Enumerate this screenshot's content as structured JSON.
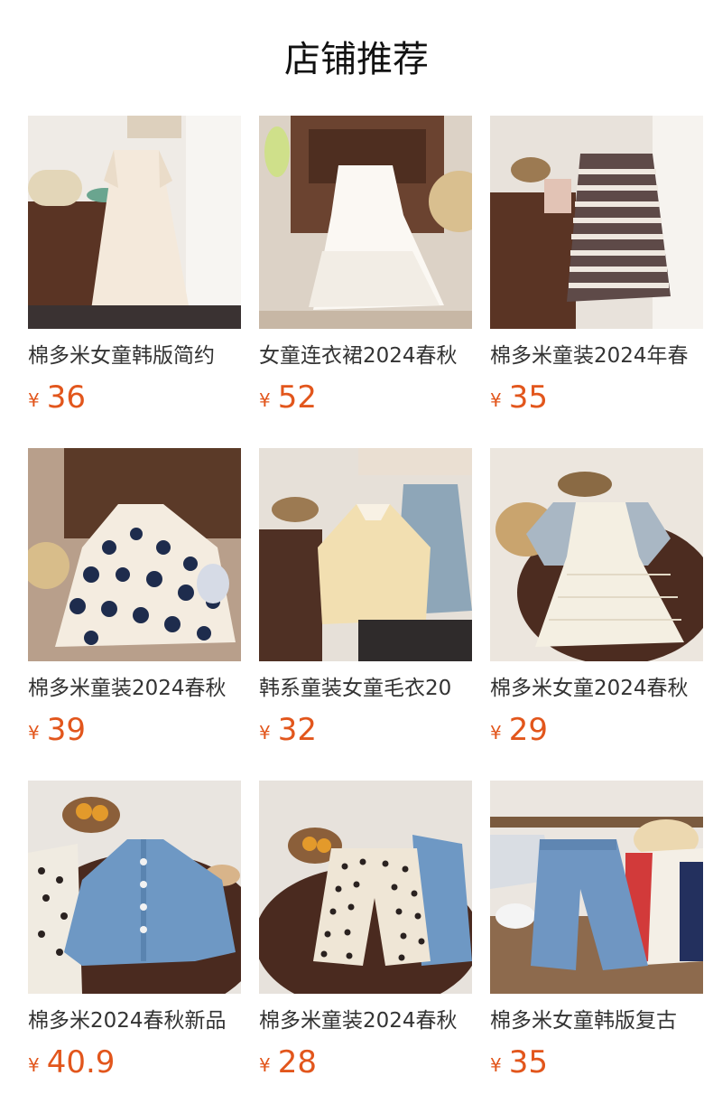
{
  "header": {
    "title": "店铺推荐"
  },
  "currency_symbol": "¥",
  "products": [
    {
      "name": "棉多米女童韩版简约",
      "price": "36",
      "image_icon": "cream-dress-photo"
    },
    {
      "name": "女童连衣裙2024春秋",
      "price": "52",
      "image_icon": "white-lace-dress-photo"
    },
    {
      "name": "棉多米童装2024年春",
      "price": "35",
      "image_icon": "striped-dress-photo"
    },
    {
      "name": "棉多米童装2024春秋",
      "price": "39",
      "image_icon": "polka-dot-dress-photo"
    },
    {
      "name": "韩系童装女童毛衣20",
      "price": "32",
      "image_icon": "cardigan-and-jeans-photo"
    },
    {
      "name": "棉多米女童2024春秋",
      "price": "29",
      "image_icon": "lace-pinafore-dress-photo"
    },
    {
      "name": "棉多米2024春秋新品",
      "price": "40.9",
      "image_icon": "denim-jacket-photo"
    },
    {
      "name": "棉多米童装2024春秋",
      "price": "28",
      "image_icon": "polka-dot-pants-photo"
    },
    {
      "name": "棉多米女童韩版复古",
      "price": "35",
      "image_icon": "wide-leg-jeans-photo"
    }
  ]
}
